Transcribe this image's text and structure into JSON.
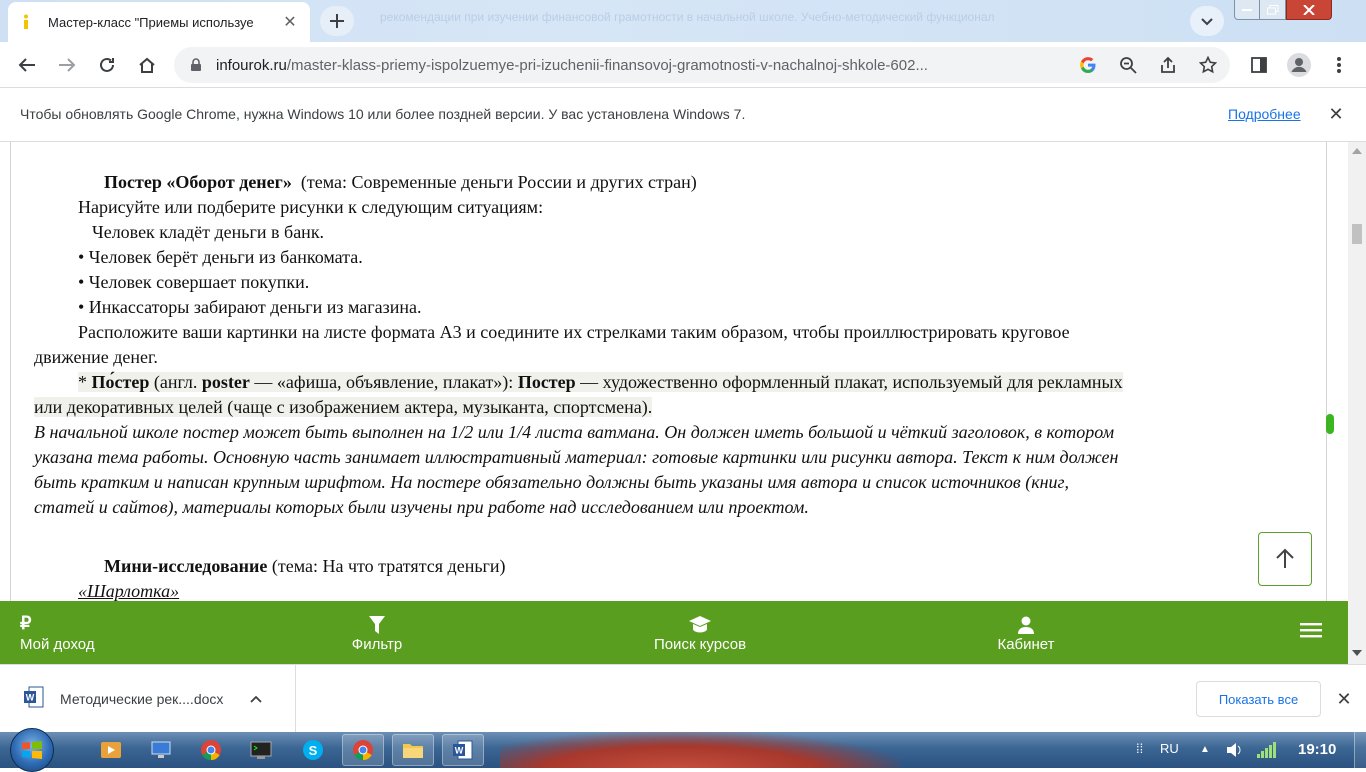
{
  "browser": {
    "tab_title": "Мастер-класс \"Приемы используе",
    "tab_close": "✕",
    "background_banner": "рекомендации при изучении финансовой грамотности в начальной школе. Учебно-методический функционал",
    "url_host": "infourok.ru",
    "url_path": "/master-klass-priemy-ispolzuemye-pri-izuchenii-finansovoj-gramotnosti-v-nachalnoj-shkole-602...",
    "icons": [
      "back-arrow-icon",
      "forward-arrow-icon",
      "reload-icon",
      "home-icon",
      "lock-icon",
      "google-icon",
      "zoom-icon",
      "share-icon",
      "star-icon",
      "side-panel-icon",
      "profile-icon",
      "kebab-menu-icon"
    ]
  },
  "infobar": {
    "message": "Чтобы обновлять Google Chrome, нужна Windows 10 или более поздней версии. У вас установлена Windows 7.",
    "link": "Подробнее",
    "close": "✕"
  },
  "doc": {
    "poster_title": "Постер «Оборот денег»",
    "poster_theme": "(тема: Современные деньги России и других стран)",
    "instruction": "Нарисуйте или подберите рисунки к следующим ситуациям:",
    "situations": [
      "Человек кладёт деньги в банк.",
      "• Человек берёт деньги из банкомата.",
      "• Человек совершает покупки.",
      "• Инкассаторы забирают деньги из магазина."
    ],
    "arrange_line1": "Расположите ваши картинки на листе формата А3 и соедините их стрелками таким образом, чтобы проиллюстрировать круговое",
    "arrange_line2": "движение денег.",
    "def_star": "* ",
    "def_term": "По́стер",
    "def_lang": " (англ. ",
    "def_en": "poster",
    "def_meaning": " — «афиша, объявление, плакат»): ",
    "def_term2": "Постер",
    "def_rest1": " — художественно оформленный плакат, используемый для рекламных",
    "def_rest2": "или декоративных целей (чаще с изображением актера, музыканта, спортсмена).",
    "italic_lines": [
      "В начальной школе постер может быть выполнен на 1/2 или 1/4 листа ватмана. Он должен иметь большой и чёткий заголовок, в котором",
      "указана тема работы. Основную часть занимает иллюстративный материал: готовые картинки или рисунки автора. Текст к ним должен",
      "быть кратким и написан крупным шрифтом. На постере обязательно должны быть указаны имя автора и список источников (книг,",
      "статей и сайтов), материалы которых были изучены при работе над исследованием или проектом."
    ],
    "mini_title": "Мини-исследование",
    "mini_theme": " (тема: На что тратятся деньги)",
    "sharlotka": "«Шарлотка»"
  },
  "nav": {
    "items": [
      {
        "label": "Мой доход",
        "icon": "ruble-icon"
      },
      {
        "label": "Фильтр",
        "icon": "filter-icon"
      },
      {
        "label": "Поиск курсов",
        "icon": "graduation-cap-icon"
      },
      {
        "label": "Кабинет",
        "icon": "user-icon"
      }
    ],
    "ruble_glyph": "₽"
  },
  "downloads": {
    "file_name": "Методические рек....docx",
    "show_all": "Показать все",
    "close": "✕"
  },
  "taskbar": {
    "lang": "RU",
    "time": "19:10"
  },
  "colors": {
    "nav_green": "#5a9e20",
    "link_blue": "#1a73e8",
    "close_red": "#c94535"
  }
}
